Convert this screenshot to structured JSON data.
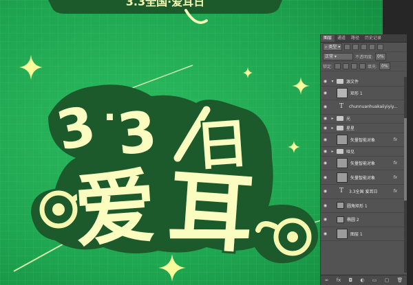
{
  "artwork": {
    "top_text": "3.3全国·爱耳日",
    "num_left": "3",
    "num_dot": ".",
    "num_right": "3",
    "char_ai": "爱",
    "char_er": "耳",
    "char_ri": "日",
    "colors": {
      "bg": "#1fa650",
      "bg_dark": "#0f7a35",
      "outline": "#1c5a2c",
      "fill": "#fbfcc0",
      "text": "#f2f7a8"
    }
  },
  "layers_panel": {
    "tabs": [
      "图层",
      "通道",
      "路径",
      "历史记录"
    ],
    "kind_filter": "类型",
    "blend_mode": "正常",
    "opacity_label": "不透明度:",
    "opacity_value": "0%",
    "lock_label": "锁定:",
    "fill_label": "填充:",
    "fill_value": "0%",
    "layers": [
      {
        "name": "源文件",
        "type": "group",
        "expanded": true
      },
      {
        "name": "矩形 1",
        "type": "shape"
      },
      {
        "name": "chunnuanhuakaiiyiyiy...",
        "type": "text"
      },
      {
        "name": "光",
        "type": "group"
      },
      {
        "name": "星星",
        "type": "group"
      },
      {
        "name": "矢量智能对象",
        "type": "smart",
        "fx": true
      },
      {
        "name": "哑见",
        "type": "group"
      },
      {
        "name": "矢量智能对象",
        "type": "smart",
        "fx": true
      },
      {
        "name": "矢量智能对象",
        "type": "smart",
        "fx": true
      },
      {
        "name": "3.3全国   爱耳日",
        "type": "text",
        "fx": true
      },
      {
        "name": "圆角矩形 1",
        "type": "shape"
      },
      {
        "name": "椭圆 2",
        "type": "shape"
      },
      {
        "name": "图层 1",
        "type": "pixel"
      }
    ],
    "bottom_icons": [
      "link-icon",
      "fx-icon",
      "mask-icon",
      "adjustment-icon",
      "group-icon",
      "new-layer-icon",
      "trash-icon"
    ]
  }
}
